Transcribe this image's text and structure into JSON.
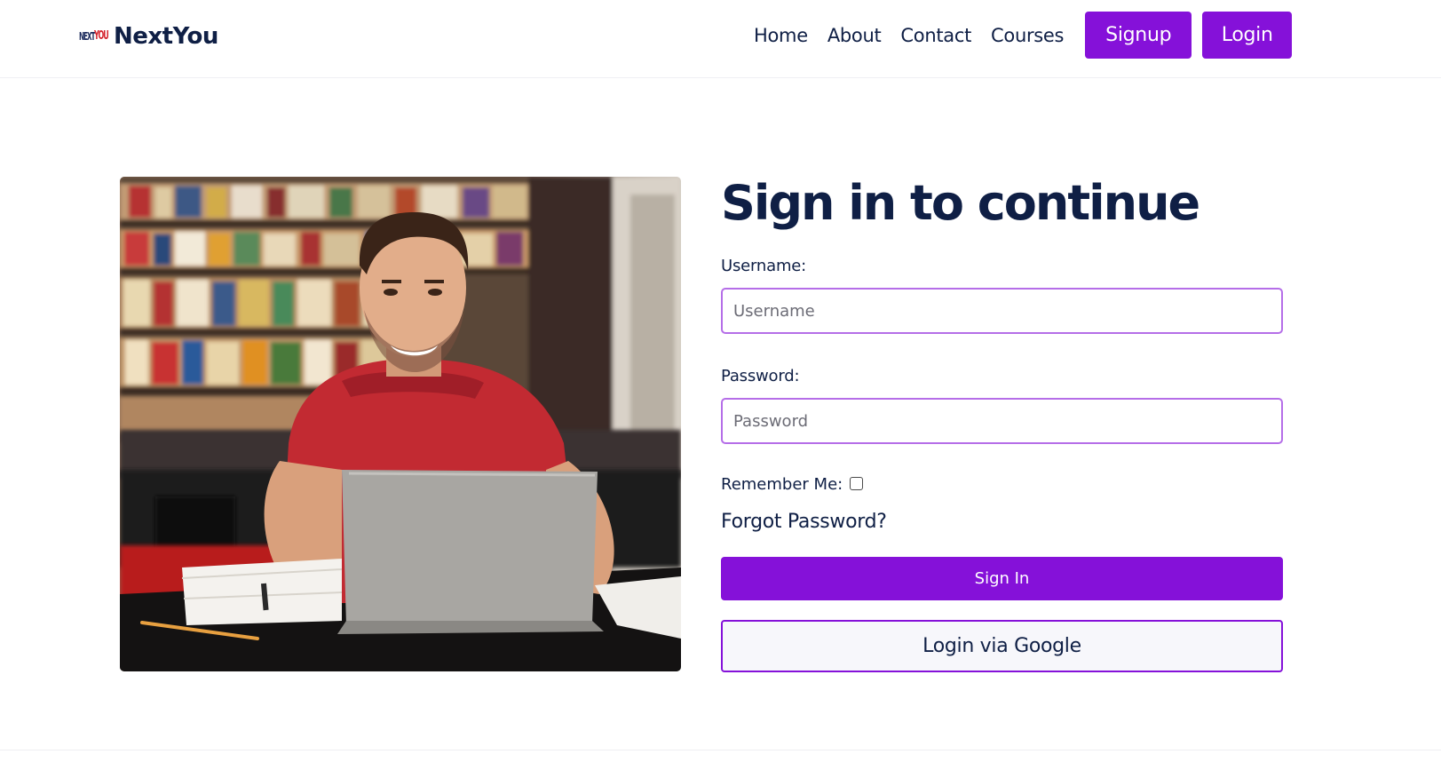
{
  "navbar": {
    "brand_logo_text_a": "NEXT",
    "brand_logo_text_b": "YOU",
    "brand_name": "NextYou",
    "links": [
      "Home",
      "About",
      "Contact",
      "Courses"
    ],
    "signup_label": "Signup",
    "login_label": "Login"
  },
  "colors": {
    "accent": "#8511d9",
    "heading": "#0f1f45",
    "input_border": "#b56ee8"
  },
  "hero_image": {
    "icon": "student-with-laptop-photo"
  },
  "form": {
    "title": "Sign in to continue",
    "username_label": "Username:",
    "username_placeholder": "Username",
    "username_value": "",
    "password_label": "Password:",
    "password_placeholder": "Password",
    "password_value": "",
    "remember_label": "Remember Me:",
    "remember_checked": false,
    "forgot_label": "Forgot Password?",
    "signin_label": "Sign In",
    "google_label": "Login via Google"
  }
}
